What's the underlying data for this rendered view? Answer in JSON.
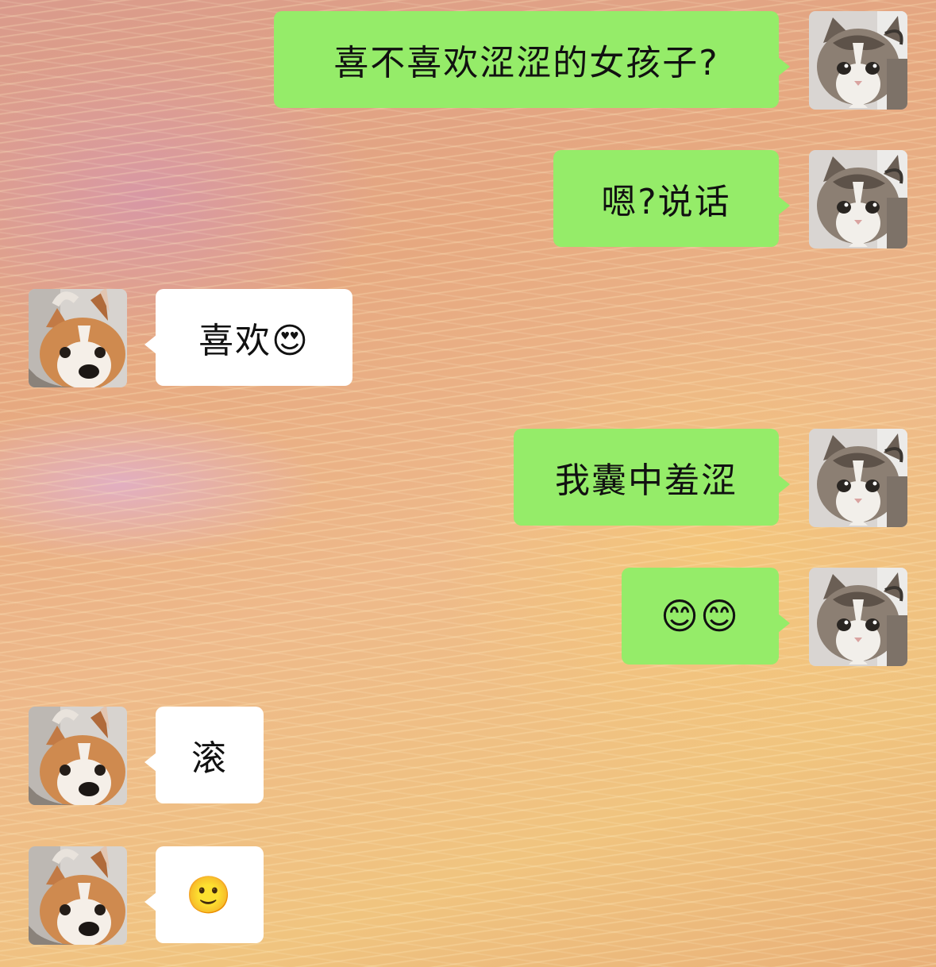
{
  "messages": [
    {
      "sender": "cat",
      "text": "喜不喜欢涩涩的女孩子?"
    },
    {
      "sender": "cat",
      "text": "嗯?说话"
    },
    {
      "sender": "corgi",
      "text": "喜欢😍"
    },
    {
      "sender": "cat",
      "text": "我囊中羞涩"
    },
    {
      "sender": "cat",
      "text": "😊😊"
    },
    {
      "sender": "corgi",
      "text": "滚"
    },
    {
      "sender": "corgi",
      "text": "🙂"
    }
  ],
  "colors": {
    "sent_bubble": "#95ec69",
    "received_bubble": "#ffffff",
    "text": "#111111"
  },
  "avatars": {
    "cat": "cat-avatar",
    "corgi": "corgi-avatar"
  }
}
